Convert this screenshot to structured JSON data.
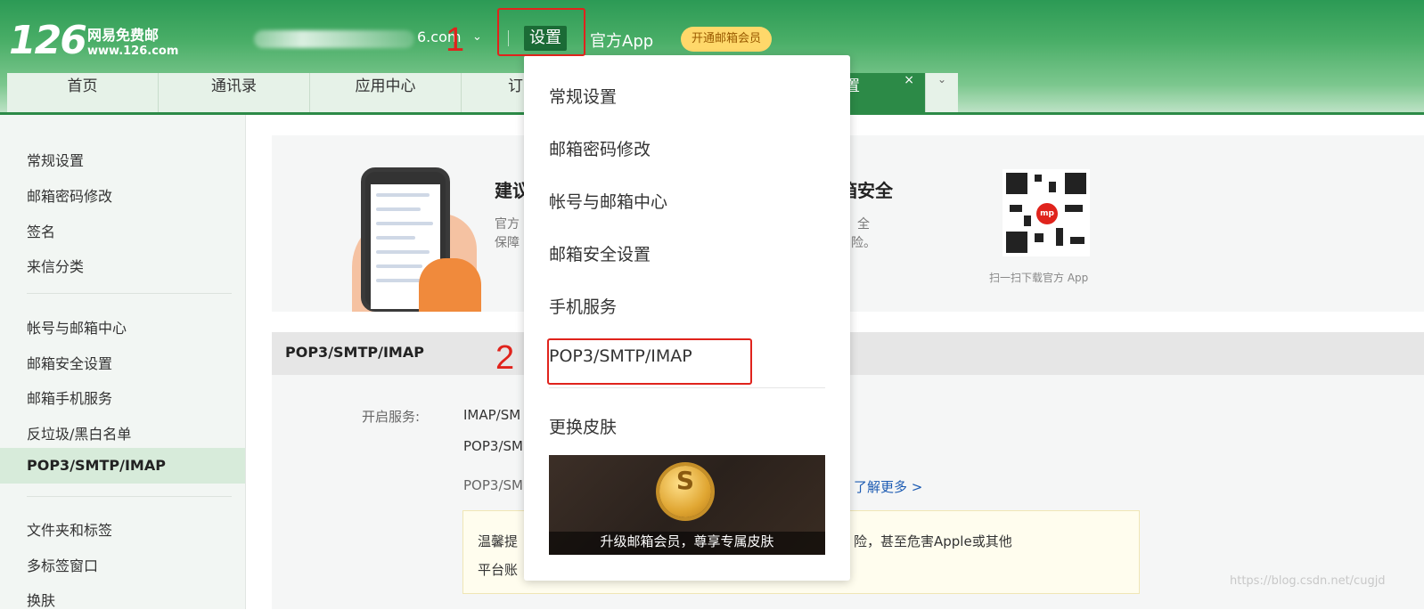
{
  "brand": {
    "logo_number": "126",
    "logo_name": "网易免费邮",
    "logo_url": "www.126.com"
  },
  "header": {
    "account_suffix": "6.com",
    "settings_label": "设置",
    "app_label": "官方App",
    "vip_label": "开通邮箱会员"
  },
  "annotations": {
    "step1": "1",
    "step2": "2"
  },
  "tabs": [
    {
      "label": "首页"
    },
    {
      "label": "通讯录"
    },
    {
      "label": "应用中心"
    },
    {
      "label": "订"
    }
  ],
  "active_tab": {
    "label": "置",
    "close": "×"
  },
  "tab_more": "⌄",
  "sidebar": {
    "group1": [
      "常规设置",
      "邮箱密码修改",
      "签名",
      "来信分类"
    ],
    "group2": [
      "帐号与邮箱中心",
      "邮箱安全设置",
      "邮箱手机服务",
      "反垃圾/黑白名单",
      "POP3/SMTP/IMAP"
    ],
    "group3": [
      "文件夹和标签",
      "多标签窗口",
      "换肤"
    ],
    "active": "POP3/SMTP/IMAP"
  },
  "banner": {
    "title_left": "建议",
    "title_right": "箱安全",
    "sub_left_1": "官方",
    "sub_left_2": "保障",
    "sub_right_1": "全",
    "sub_right_2": "险。",
    "qr_caption": "扫一扫下载官方 App"
  },
  "section": {
    "title": "POP3/SMTP/IMAP",
    "service_label": "开启服务:",
    "service_lines": [
      "IMAP/SM",
      "POP3/SM",
      "POP3/SM"
    ],
    "learn_more": "了解更多 >",
    "tip_line1_left": "温馨提",
    "tip_line1_right": "险，甚至危害Apple或其他",
    "tip_line2_left": "平台账"
  },
  "dropdown": {
    "items": [
      "常规设置",
      "邮箱密码修改",
      "帐号与邮箱中心",
      "邮箱安全设置",
      "手机服务",
      "POP3/SMTP/IMAP",
      "更换皮肤"
    ],
    "promo_caption": "升级邮箱会员，尊享专属皮肤",
    "promo_coin": "S"
  },
  "watermark": "https://blog.csdn.net/cugjd",
  "colors": {
    "brand_green": "#2c8a47",
    "annotation_red": "#e0231c",
    "vip_yellow": "#ffd86a",
    "link_blue": "#1e5cb3"
  }
}
